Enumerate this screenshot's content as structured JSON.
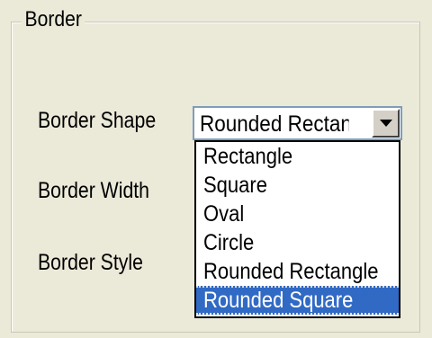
{
  "group": {
    "title": "Border"
  },
  "labels": {
    "shape": "Border Shape",
    "width": "Border Width",
    "style": "Border Style"
  },
  "combo": {
    "value": "Rounded Rectangle",
    "options": [
      "Rectangle",
      "Square",
      "Oval",
      "Circle",
      "Rounded Rectangle",
      "Rounded Square"
    ],
    "highlighted": "Rounded Square"
  },
  "colors": {
    "background": "#ebe9d8",
    "selection": "#316ac5",
    "combo_border": "#7f9db9"
  },
  "icons": {
    "dropdown": "chevron-down-icon"
  }
}
